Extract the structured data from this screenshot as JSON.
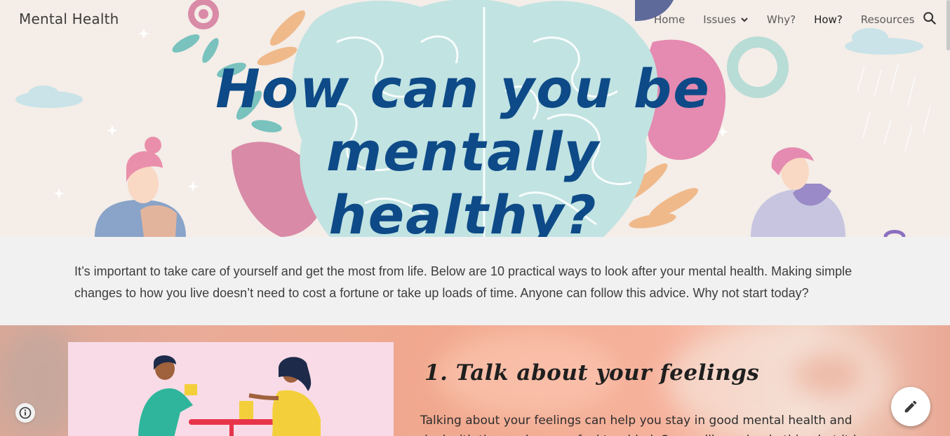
{
  "header": {
    "site_title": "Mental Health",
    "nav": [
      {
        "label": "Home",
        "active": false
      },
      {
        "label": "Issues",
        "active": false,
        "has_dropdown": true
      },
      {
        "label": "Why?",
        "active": false
      },
      {
        "label": "How?",
        "active": true
      },
      {
        "label": "Resources",
        "active": false
      }
    ],
    "search_icon": "search-icon"
  },
  "hero": {
    "title_line1": "How can you be mentally",
    "title_line2": "healthy?",
    "title_color": "#0d4a87"
  },
  "intro": {
    "text": "It’s important to take care of yourself and get the most from life. Below are 10 practical ways to look after your mental health. Making simple changes to how you live doesn’t need to cost a fortune or take up loads of time. Anyone can follow this advice. Why not start today?"
  },
  "section1": {
    "heading": "1. Talk about your feelings",
    "body": "Talking about your feelings can help you stay in good mental health and deal with times when you feel troubled. Seems like a simple thing but it is"
  },
  "controls": {
    "info_icon": "info-icon",
    "edit_icon": "pencil-icon"
  }
}
